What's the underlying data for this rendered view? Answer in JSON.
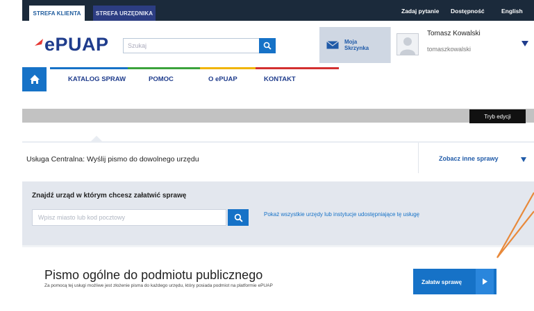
{
  "topbar": {
    "zone_client": "STREFA KLIENTA",
    "zone_clerk": "STREFA URZĘDNIKA",
    "ask": "Zadaj pytanie",
    "accessibility": "Dostępność",
    "english": "English"
  },
  "header": {
    "logo": "ePUAP",
    "search_placeholder": "Szukaj",
    "inbox_label": "Moja Skrzynka",
    "user_name": "Tomasz Kowalski",
    "user_login": "tomaszkowalski"
  },
  "nav": {
    "items": [
      "KATALOG SPRAW",
      "POMOC",
      "O ePUAP",
      "KONTAKT"
    ],
    "stripe_colors": [
      "#1672c7",
      "#3aa23a",
      "#f0b400",
      "#d32f2f"
    ]
  },
  "edit_mode": "Tryb edycji",
  "service": {
    "title": "Usługa Centralna: Wyślij pismo do dowolnego urzędu",
    "other_link": "Zobacz inne sprawy"
  },
  "find": {
    "title": "Znajdź urząd w którym chcesz załatwić sprawę",
    "placeholder": "Wpisz miasto lub kod pocztowy",
    "link": "Pokaż wszystkie urzędy lub instytucje udostępniające tę usługę"
  },
  "document": {
    "title": "Pismo ogólne do podmiotu publicznego",
    "description": "Za pomocą tej usługi możliwe jest złożenie pisma do każdego urzędu, który posiada podmiot na platformie ePUAP",
    "button": "Załatw sprawę"
  },
  "colors": {
    "accent": "#1672c7",
    "dark": "#1b2a3b",
    "annotation": "#e8893a"
  }
}
